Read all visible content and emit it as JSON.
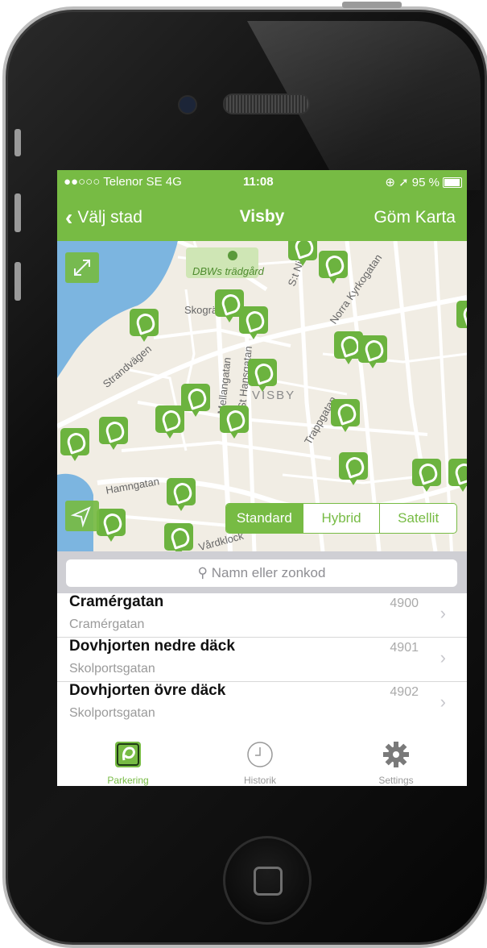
{
  "status_bar": {
    "carrier": "●●○○○ Telenor SE  4G",
    "time": "11:08",
    "battery": "⊕ ➚ 95 %"
  },
  "nav": {
    "back_label": "Välj stad",
    "title": "Visby",
    "hide_map_label": "Göm Karta"
  },
  "map": {
    "labels": {
      "garden": "DBWs trädgård",
      "town": "VISBY",
      "hamngatan": "Hamngatan",
      "strandvagen": "Strandvägen",
      "mellangatan": "Mellangatan",
      "hansgatan": "St Hansgatan",
      "trappgatan": "Trappgatan",
      "skogranden": "Skogränd",
      "norra": "Norra Kyrkogatan",
      "stnik": "S:t Nik",
      "vardklock": "Vårdklock"
    },
    "map_types": [
      "Standard",
      "Hybrid",
      "Satellit"
    ],
    "selected_map_type": "Standard"
  },
  "search": {
    "placeholder": "Namn eller zonkod"
  },
  "zones": [
    {
      "name": "Cramérgatan",
      "street": "Cramérgatan",
      "code": "4900"
    },
    {
      "name": "Dovhjorten nedre däck",
      "street": "Skolportsgatan",
      "code": "4901"
    },
    {
      "name": "Dovhjorten övre däck",
      "street": "Skolportsgatan",
      "code": "4902"
    }
  ],
  "tabs": [
    {
      "label": "Parkering",
      "icon": "parking-icon",
      "active": true
    },
    {
      "label": "Historik",
      "icon": "clock-icon",
      "active": false
    },
    {
      "label": "Settings",
      "icon": "gear-icon",
      "active": false
    }
  ],
  "colors": {
    "accent": "#77bb44",
    "water": "#7cb5e0",
    "land": "#f1ede4"
  }
}
